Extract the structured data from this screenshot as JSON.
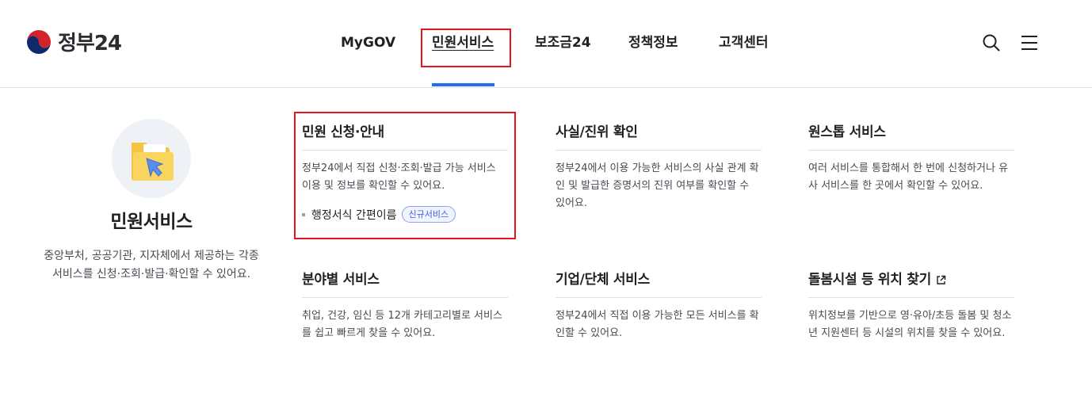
{
  "brand": {
    "logo_text": "정부24",
    "logo_icon": "taegeuk-logo"
  },
  "nav": {
    "items": [
      {
        "label": "MyGOV",
        "active": false
      },
      {
        "label": "민원서비스",
        "active": true
      },
      {
        "label": "보조금24",
        "active": false
      },
      {
        "label": "정책정보",
        "active": false
      },
      {
        "label": "고객센터",
        "active": false
      }
    ]
  },
  "utility": {
    "search_icon": "search-icon",
    "menu_icon": "hamburger-menu-icon"
  },
  "intro": {
    "illustration": "folder-cursor-illustration",
    "title": "민원서비스",
    "description": "중앙부처, 공공기관, 지자체에서 제공하는 각종 서비스를 신청·조회·발급·확인할 수 있어요."
  },
  "cards": [
    {
      "title": "민원 신청·안내",
      "description": "정부24에서 직접 신청·조회·발급 가능 서비스 이용 및 정보를 확인할 수 있어요.",
      "sub_link": "행정서식 간편이름",
      "badge": "신규서비스"
    },
    {
      "title": "사실/진위 확인",
      "description": "정부24에서 이용 가능한 서비스의 사실 관계 확인 및 발급한 증명서의 진위 여부를 확인할 수 있어요."
    },
    {
      "title": "원스톱 서비스",
      "description": "여러 서비스를 통합해서 한 번에 신청하거나 유사 서비스를 한 곳에서 확인할 수 있어요."
    },
    {
      "title": "분야별 서비스",
      "description": "취업, 건강, 임신 등 12개 카테고리별로 서비스를 쉽고 빠르게 찾을 수 있어요."
    },
    {
      "title": "기업/단체 서비스",
      "description": "정부24에서 직접 이용 가능한 모든 서비스를 확인할 수 있어요."
    },
    {
      "title": "돌봄시설 등 위치 찾기",
      "title_icon": "external-link-icon",
      "description": "위치정보를 기반으로 영·유아/초등 돌봄 및 청소년 지원센터 등 시설의 위치를 찾을 수 있어요."
    }
  ],
  "colors": {
    "accent": "#256ef4",
    "highlight": "#e8141d",
    "badge_text": "#3d5ee0"
  }
}
